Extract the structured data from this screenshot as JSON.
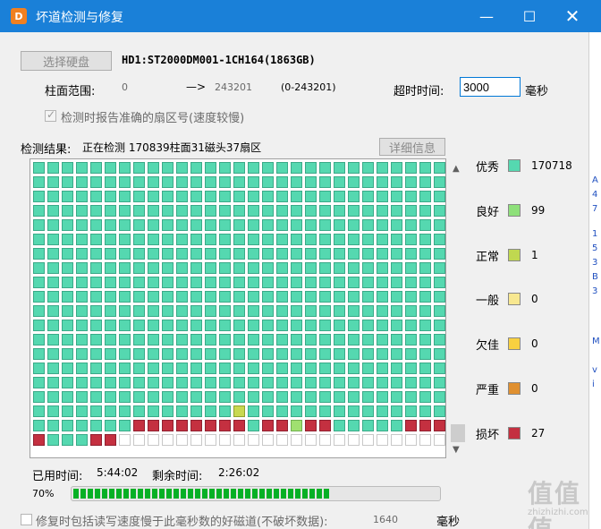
{
  "window": {
    "title": "坏道检测与修复",
    "icon_label": "D"
  },
  "toolbar": {
    "select_disk_label": "选择硬盘",
    "disk_info": "HD1:ST2000DM001-1CH164(1863GB)"
  },
  "range": {
    "label": "柱面范围:",
    "start": "0",
    "arrow": "—>",
    "end": "243201",
    "full_range": "(0-243201)"
  },
  "timeout": {
    "label": "超时时间:",
    "value": "3000",
    "unit": "毫秒"
  },
  "report_option": {
    "label": "检测时报告准确的扇区号(速度较慢)",
    "checked": true
  },
  "result": {
    "label": "检测结果:",
    "status": "正在检测 170839柱面31磁头37扇区",
    "details_button": "详细信息"
  },
  "legend": [
    {
      "name": "优秀",
      "count": "170718",
      "color": "#55d8b0"
    },
    {
      "name": "良好",
      "count": "99",
      "color": "#8ee07a"
    },
    {
      "name": "正常",
      "count": "1",
      "color": "#c0d850"
    },
    {
      "name": "一般",
      "count": "0",
      "color": "#f8e890"
    },
    {
      "name": "欠佳",
      "count": "0",
      "color": "#f8d040"
    },
    {
      "name": "严重",
      "count": "0",
      "color": "#e09030"
    },
    {
      "name": "损坏",
      "count": "27",
      "color": "#c43040"
    }
  ],
  "time": {
    "elapsed_label": "已用时间:",
    "elapsed": "5:44:02",
    "remaining_label": "剩余时间:",
    "remaining": "2:26:02"
  },
  "progress": {
    "percent_label": "70%",
    "value": 0.7
  },
  "repair_option": {
    "label": "修复时包括读写速度慢于此毫秒数的好磁道(不破坏数据):",
    "value": "1640",
    "unit": "毫秒",
    "checked": false
  },
  "watermark": {
    "logo": "值值值",
    "site": "zhizhizhi.com"
  },
  "colors": {
    "titlebar": "#1a80d8",
    "good": "#55d8b0",
    "bad": "#c43040",
    "progress": "#06b025"
  }
}
